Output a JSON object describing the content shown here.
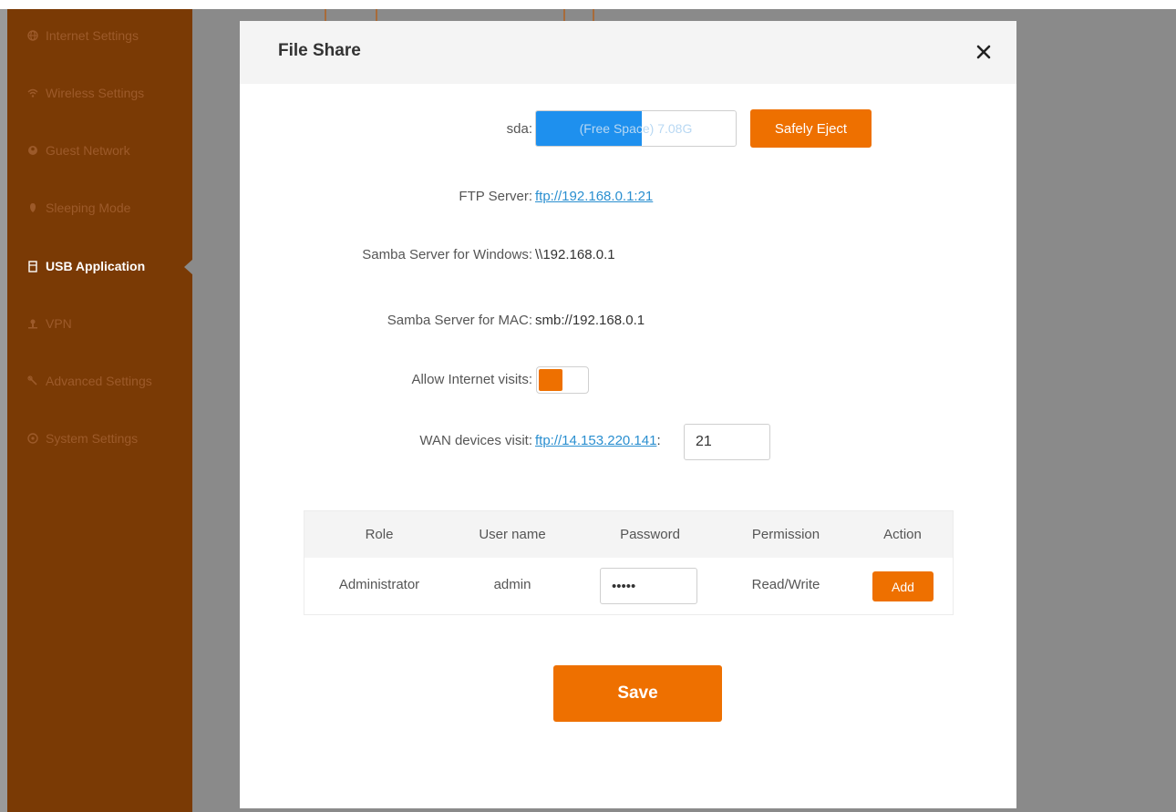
{
  "sidebar": {
    "items": [
      {
        "label": "Internet Settings",
        "icon": "globe-icon"
      },
      {
        "label": "Wireless Settings",
        "icon": "wifi-icon"
      },
      {
        "label": "Guest Network",
        "icon": "guest-icon"
      },
      {
        "label": "Sleeping Mode",
        "icon": "moon-icon"
      },
      {
        "label": "USB Application",
        "icon": "usb-icon",
        "active": true
      },
      {
        "label": "VPN",
        "icon": "vpn-icon"
      },
      {
        "label": "Advanced Settings",
        "icon": "wrench-icon"
      },
      {
        "label": "System Settings",
        "icon": "gear-icon"
      }
    ]
  },
  "modal": {
    "title": "File Share",
    "close_icon": "close-icon"
  },
  "storage": {
    "label": "sda:",
    "bar_text": "(Free Space) 7.08G",
    "used_fraction": 0.53,
    "eject_label": "Safely Eject"
  },
  "ftp": {
    "label": "FTP Server:",
    "value": "ftp://192.168.0.1:21"
  },
  "samba_windows": {
    "label": "Samba Server for Windows:",
    "value": "\\\\192.168.0.1"
  },
  "samba_mac": {
    "label": "Samba Server for MAC:",
    "value": "smb://192.168.0.1"
  },
  "internet_visits": {
    "label": "Allow Internet visits:",
    "enabled": true
  },
  "wan": {
    "label": "WAN devices visit:",
    "link": "ftp://14.153.220.141",
    "separator": ":",
    "port": "21"
  },
  "users_table": {
    "columns": [
      "Role",
      "User name",
      "Password",
      "Permission",
      "Action"
    ],
    "rows": [
      {
        "role": "Administrator",
        "username": "admin",
        "password": "•••••",
        "permission": "Read/Write",
        "action": "Add"
      }
    ]
  },
  "save_label": "Save",
  "colors": {
    "accent": "#ee7000",
    "sidebar": "#7a3a05",
    "progress": "#1e90ee",
    "link": "#2a8fd0"
  }
}
